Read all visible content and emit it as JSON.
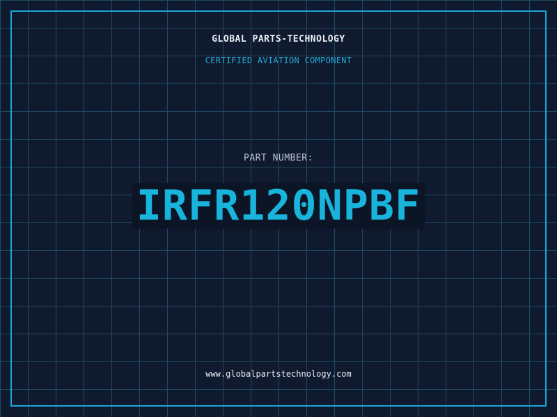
{
  "header": {
    "company_name": "GLOBAL PARTS-TECHNOLOGY",
    "tagline": "CERTIFIED AVIATION COMPONENT"
  },
  "part": {
    "label": "PART NUMBER:",
    "number": "IRFR120NPBF"
  },
  "footer": {
    "website": "www.globalpartstechnology.com"
  },
  "colors": {
    "background": "#101a2e",
    "grid": "#1f4a63",
    "accent": "#19b4dc",
    "text": "#e8edf5"
  }
}
